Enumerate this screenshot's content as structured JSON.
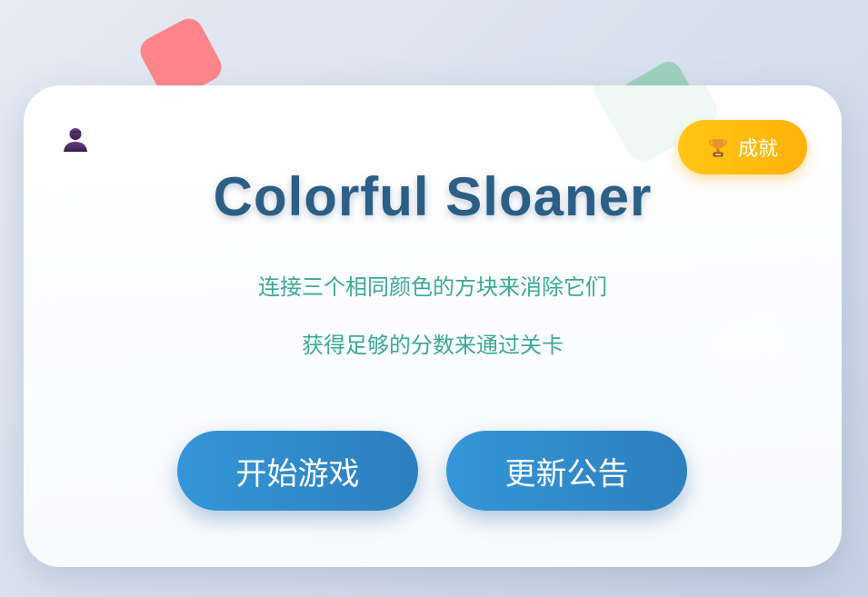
{
  "game": {
    "title": "Colorful Sloaner",
    "instructions": [
      "连接三个相同颜色的方块来消除它们",
      "获得足够的分数来通过关卡"
    ]
  },
  "header": {
    "profile_icon": "user-silhouette-icon",
    "achievements_label": "成就",
    "achievements_icon": "trophy-icon"
  },
  "buttons": {
    "start_label": "开始游戏",
    "news_label": "更新公告"
  },
  "colors": {
    "title": "#2b5f86",
    "subtitle": "#3aa99a",
    "primary_button": "#3496d8",
    "achievement_button": "#ffbc0f",
    "tile_red": "#ff858a",
    "tile_green": "#9ed1bd"
  }
}
